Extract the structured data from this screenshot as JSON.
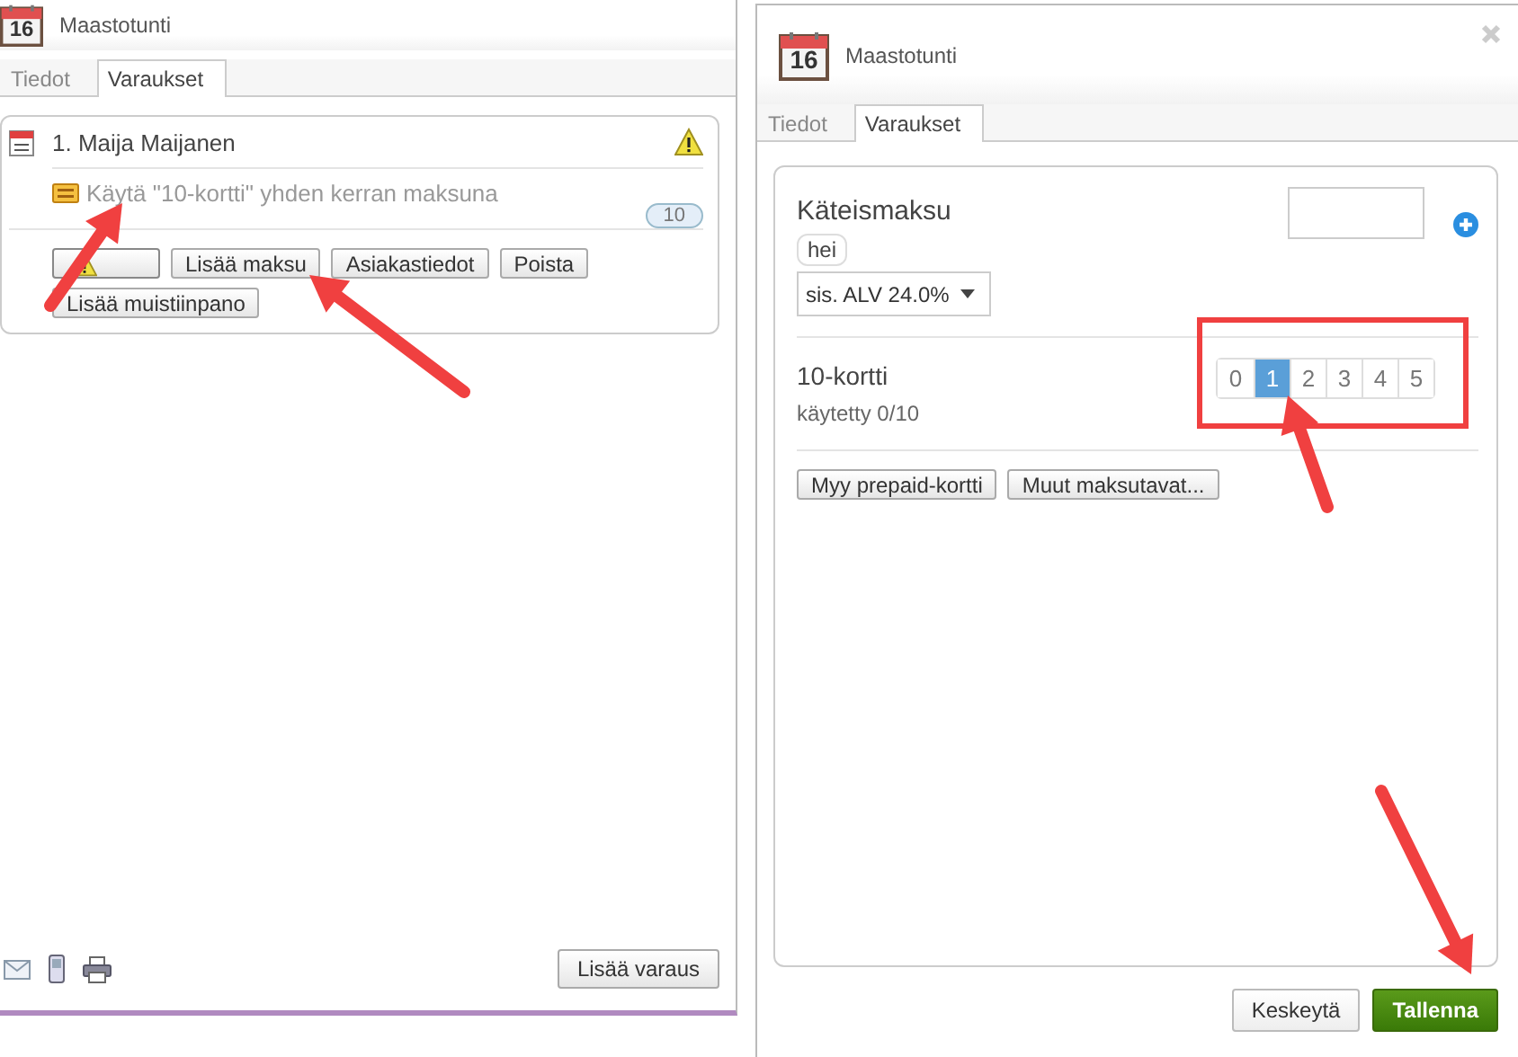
{
  "left_panel": {
    "calendar_day": "16",
    "title": "Maastotunti",
    "tabs": [
      {
        "label": "Tiedot",
        "selected": false
      },
      {
        "label": "Varaukset",
        "selected": true
      }
    ],
    "booking": {
      "name": "1. Maija Maijanen",
      "offer": "Käytä \"10-kortti\" yhden kerran maksuna",
      "count": "10",
      "buttons": [
        {
          "kind": "warning"
        },
        {
          "kind": "text",
          "label": "Lisää maksu"
        },
        {
          "kind": "text",
          "label": "Asiakastiedot"
        },
        {
          "kind": "text",
          "label": "Poista"
        },
        {
          "kind": "text",
          "label": "Lisää muistiinpano"
        }
      ]
    },
    "footer_button": "Lisää varaus"
  },
  "right_panel": {
    "calendar_day": "16",
    "title": "Maastotunti",
    "tabs": [
      {
        "label": "Tiedot",
        "selected": false
      },
      {
        "label": "Varaukset",
        "selected": true
      }
    ],
    "payment": {
      "title": "Käteismaksu",
      "tag": "hei",
      "vat_select": "sis. ALV 24.0%"
    },
    "card": {
      "title": "10-kortti",
      "usage": "käytetty 0/10",
      "options": [
        {
          "label": "0",
          "selected": false
        },
        {
          "label": "1",
          "selected": true
        },
        {
          "label": "2",
          "selected": false
        },
        {
          "label": "3",
          "selected": false
        },
        {
          "label": "4",
          "selected": false
        },
        {
          "label": "5",
          "selected": false
        }
      ]
    },
    "actions": [
      "Myy prepaid-kortti",
      "Muut maksutavat..."
    ],
    "footer_buttons": [
      {
        "label": "Keskeytä",
        "kind": "secondary"
      },
      {
        "label": "Tallenna",
        "kind": "primary"
      }
    ]
  }
}
